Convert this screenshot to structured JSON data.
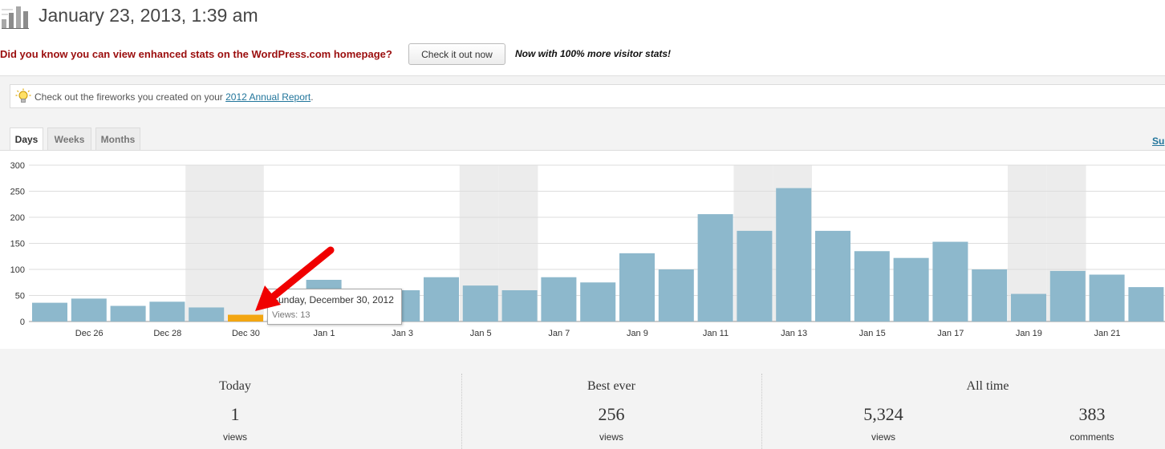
{
  "header": {
    "title": "January 23, 2013, 1:39 am",
    "icon": "stats-bar-chart-icon"
  },
  "promo": {
    "text": "Did you know you can view enhanced stats on the WordPress.com homepage?",
    "button_label": "Check it out now",
    "note": "Now with 100% more visitor stats!"
  },
  "notice": {
    "icon": "lightbulb-icon",
    "text_before": "Check out the fireworks you created on your ",
    "link_text": "2012 Annual Report",
    "text_after": "."
  },
  "tabs": [
    {
      "label": "Days",
      "active": true
    },
    {
      "label": "Weeks",
      "active": false
    },
    {
      "label": "Months",
      "active": false
    }
  ],
  "summary_link": "Su",
  "chart_data": {
    "type": "bar",
    "ylim": [
      0,
      300
    ],
    "yticks": [
      0,
      50,
      100,
      150,
      200,
      250,
      300
    ],
    "grid": true,
    "x": [
      "Dec 25",
      "Dec 26",
      "Dec 27",
      "Dec 28",
      "Dec 29",
      "Dec 30",
      "Dec 31",
      "Jan 1",
      "Jan 2",
      "Jan 3",
      "Jan 4",
      "Jan 5",
      "Jan 6",
      "Jan 7",
      "Jan 8",
      "Jan 9",
      "Jan 10",
      "Jan 11",
      "Jan 12",
      "Jan 13",
      "Jan 14",
      "Jan 15",
      "Jan 16",
      "Jan 17",
      "Jan 18",
      "Jan 19",
      "Jan 20",
      "Jan 21",
      "Jan 22"
    ],
    "tick_labels": [
      "",
      "Dec 26",
      "",
      "Dec 28",
      "",
      "Dec 30",
      "",
      "Jan 1",
      "",
      "Jan 3",
      "",
      "Jan 5",
      "",
      "Jan 7",
      "",
      "Jan 9",
      "",
      "Jan 11",
      "",
      "Jan 13",
      "",
      "Jan 15",
      "",
      "Jan 17",
      "",
      "Jan 19",
      "",
      "Jan 21",
      ""
    ],
    "values": [
      36,
      44,
      30,
      38,
      27,
      13,
      5,
      80,
      45,
      60,
      85,
      69,
      60,
      85,
      75,
      131,
      100,
      206,
      174,
      256,
      174,
      135,
      122,
      153,
      100,
      53,
      97,
      90,
      66
    ],
    "weekend_indices": [
      4,
      5,
      11,
      12,
      18,
      19,
      25,
      26
    ],
    "highlight_index": 5,
    "bar_color": "#8db8cc",
    "highlight_color": "#f3a612",
    "weekend_color": "#ececec"
  },
  "tooltip": {
    "title": "Sunday, December 30, 2012",
    "value": "Views: 13"
  },
  "stats": {
    "today": {
      "label": "Today",
      "value": "1",
      "unit": "views"
    },
    "best": {
      "label": "Best ever",
      "value": "256",
      "unit": "views"
    },
    "all_time": {
      "label": "All time",
      "views_value": "5,324",
      "views_unit": "views",
      "comments_value": "383",
      "comments_unit": "comments"
    }
  }
}
